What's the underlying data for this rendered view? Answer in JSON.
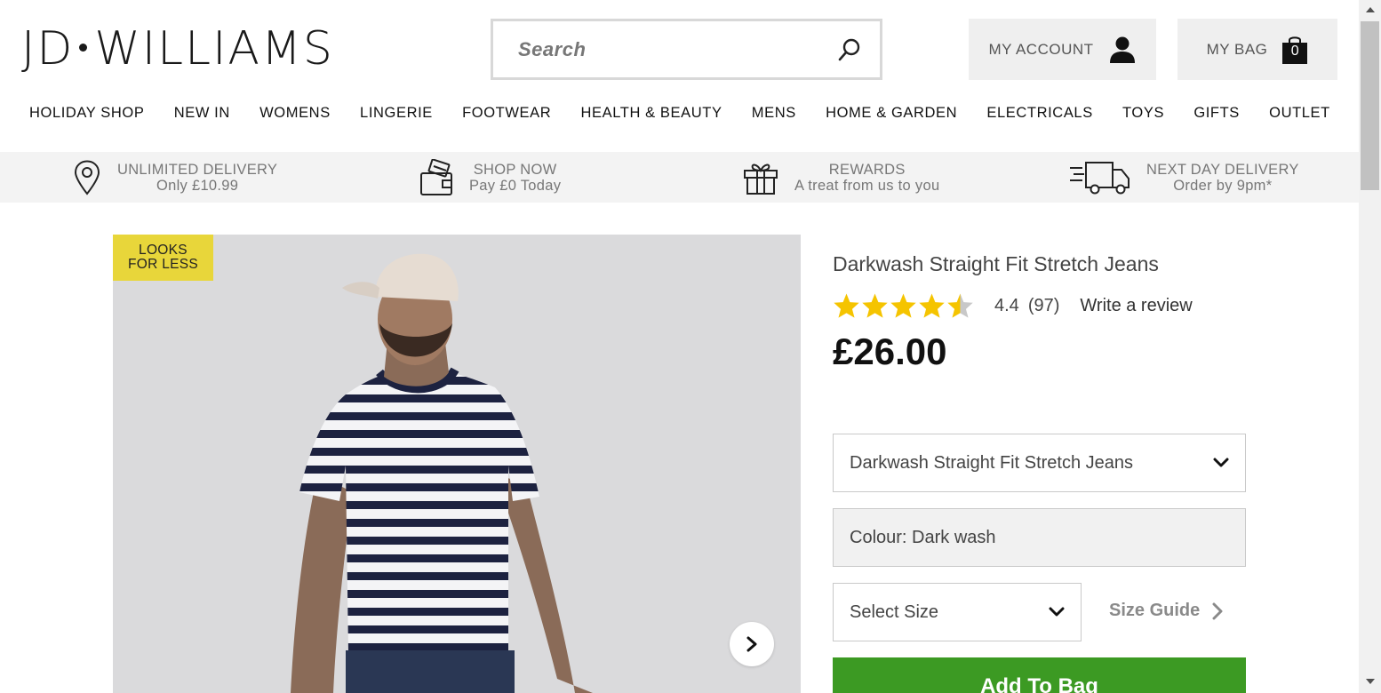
{
  "header": {
    "logo_left": "JD",
    "logo_right": "WILLIAMS",
    "search_placeholder": "Search",
    "account_label": "MY ACCOUNT",
    "bag_label": "MY BAG",
    "bag_count": "0"
  },
  "nav": [
    "HOLIDAY SHOP",
    "NEW IN",
    "WOMENS",
    "LINGERIE",
    "FOOTWEAR",
    "HEALTH & BEAUTY",
    "MENS",
    "HOME & GARDEN",
    "ELECTRICALS",
    "TOYS",
    "GIFTS",
    "OUTLET"
  ],
  "usp": [
    {
      "icon": "location-pin-icon",
      "line1": "UNLIMITED DELIVERY",
      "line2": "Only £10.99"
    },
    {
      "icon": "wallet-card-icon",
      "line1": "SHOP NOW",
      "line2": "Pay £0 Today"
    },
    {
      "icon": "gift-icon",
      "line1": "REWARDS",
      "line2": "A treat from us to you"
    },
    {
      "icon": "delivery-truck-icon",
      "line1": "NEXT DAY DELIVERY",
      "line2": "Order by 9pm*"
    }
  ],
  "product": {
    "badge_line1": "LOOKS",
    "badge_line2": "FOR LESS",
    "title": "Darkwash Straight Fit Stretch Jeans",
    "rating": 4.4,
    "rating_text": "4.4",
    "review_count": "(97)",
    "write_review": "Write a review",
    "price": "£26.00",
    "style_selected": "Darkwash Straight Fit Stretch Jeans",
    "colour": "Colour: Dark wash",
    "size_placeholder": "Select Size",
    "size_guide": "Size Guide",
    "add_to_bag": "Add To Bag"
  },
  "colors": {
    "badge": "#e8d63a",
    "star": "#f5c400",
    "add_to_bag": "#3c9a23"
  }
}
